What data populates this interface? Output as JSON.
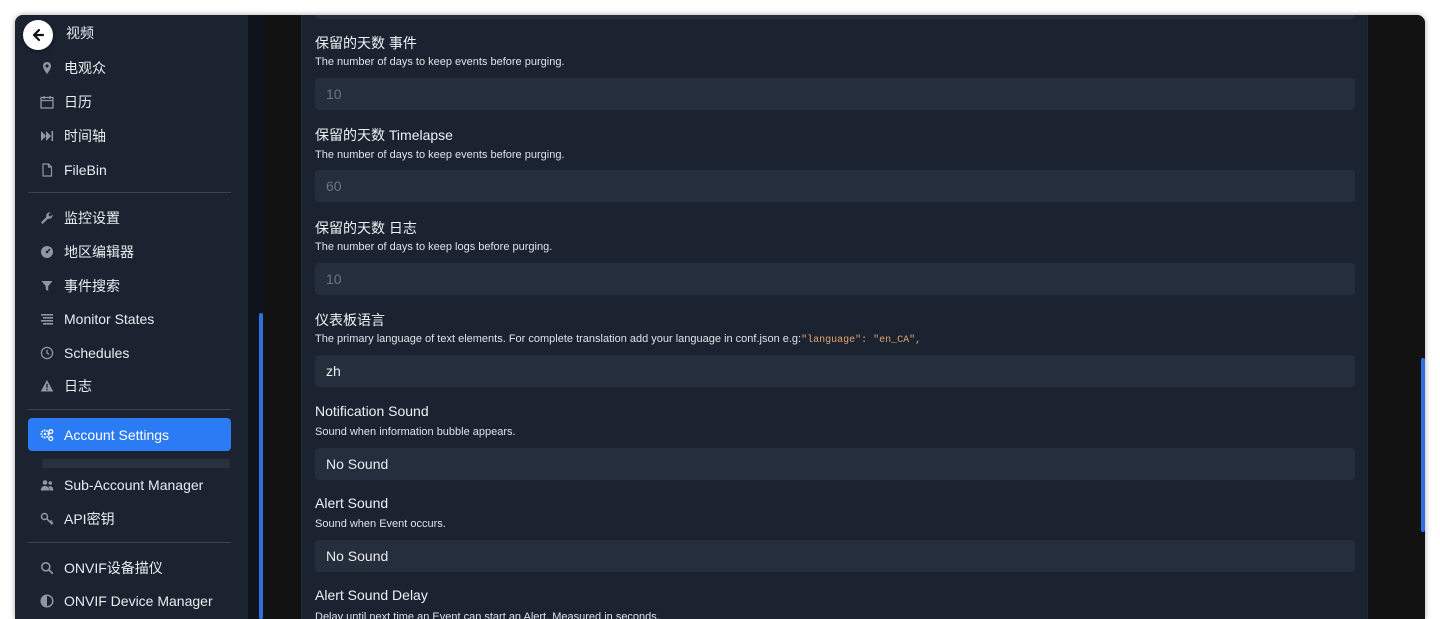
{
  "sidebar": {
    "items": [
      {
        "label": "视频",
        "icon": "video-icon"
      },
      {
        "label": "电观众",
        "icon": "map-pin-icon"
      },
      {
        "label": "日历",
        "icon": "calendar-icon"
      },
      {
        "label": "时间轴",
        "icon": "fast-forward-icon"
      },
      {
        "label": "FileBin",
        "icon": "file-icon"
      },
      {
        "label": "监控设置",
        "icon": "wrench-icon"
      },
      {
        "label": "地区编辑器",
        "icon": "dashboard-icon"
      },
      {
        "label": "事件搜索",
        "icon": "filter-icon"
      },
      {
        "label": "Monitor States",
        "icon": "list-icon"
      },
      {
        "label": "Schedules",
        "icon": "clock-icon"
      },
      {
        "label": "日志",
        "icon": "warning-icon"
      },
      {
        "label": "Account Settings",
        "icon": "gears-icon"
      },
      {
        "label": "Sub-Account Manager",
        "icon": "users-icon"
      },
      {
        "label": "API密钥",
        "icon": "key-icon"
      },
      {
        "label": "ONVIF设备描仪",
        "icon": "search-icon"
      },
      {
        "label": "ONVIF Device Manager",
        "icon": "circle-half-icon"
      }
    ]
  },
  "settings": {
    "days_events": {
      "label": "保留的天数 事件",
      "desc": "The number of days to keep events before purging.",
      "placeholder": "10"
    },
    "days_timelapse": {
      "label": "保留的天数 Timelapse",
      "desc": "The number of days to keep events before purging.",
      "placeholder": "60"
    },
    "days_logs": {
      "label": "保留的天数 日志",
      "desc": "The number of days to keep logs before purging.",
      "placeholder": "10"
    },
    "language": {
      "label": "仪表板语言",
      "desc": "The primary language of text elements. For complete translation add your language in conf.json e.g:",
      "code": "\"language\": \"en_CA\",",
      "value": "zh"
    },
    "notification_sound": {
      "label": "Notification Sound",
      "desc": "Sound when information bubble appears.",
      "value": "No Sound"
    },
    "alert_sound": {
      "label": "Alert Sound",
      "desc": "Sound when Event occurs.",
      "value": "No Sound"
    },
    "alert_sound_delay": {
      "label": "Alert Sound Delay",
      "desc": "Delay until next time an Event can start an Alert. Measured in seconds."
    }
  },
  "colors": {
    "accent": "#2b7cf4",
    "panel": "#1b2230",
    "input": "#242e3c",
    "code": "#e4a46e"
  }
}
